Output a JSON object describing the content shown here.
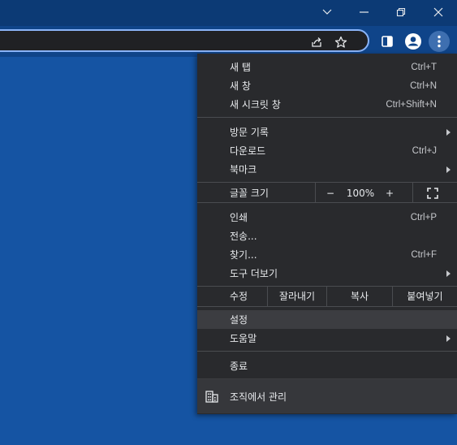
{
  "window": {
    "minimize_icon": "chevron-down-icon",
    "restore_icon": "restore-icon",
    "close_icon": "close-icon"
  },
  "menu": {
    "group1": [
      {
        "label": "새 탭",
        "shortcut": "Ctrl+T"
      },
      {
        "label": "새 창",
        "shortcut": "Ctrl+N"
      },
      {
        "label": "새 시크릿 창",
        "shortcut": "Ctrl+Shift+N"
      }
    ],
    "group2": [
      {
        "label": "방문 기록",
        "shortcut": ""
      },
      {
        "label": "다운로드",
        "shortcut": "Ctrl+J"
      },
      {
        "label": "북마크",
        "shortcut": ""
      }
    ],
    "zoom": {
      "label": "글꼴 크기",
      "minus": "−",
      "value": "100%",
      "plus": "+"
    },
    "group3": [
      {
        "label": "인쇄",
        "shortcut": "Ctrl+P"
      },
      {
        "label": "전송...",
        "shortcut": ""
      },
      {
        "label": "찾기...",
        "shortcut": "Ctrl+F"
      },
      {
        "label": "도구 더보기",
        "shortcut": ""
      }
    ],
    "edit": {
      "label": "수정",
      "cut": "잘라내기",
      "copy": "복사",
      "paste": "붙여넣기"
    },
    "group4": [
      {
        "label": "설정"
      },
      {
        "label": "도움말"
      }
    ],
    "exit": "종료",
    "managed": "조직에서 관리"
  },
  "colors": {
    "accent": "#8ab4f8",
    "menu_bg": "#292a2d",
    "page_bg": "#1554a3"
  }
}
